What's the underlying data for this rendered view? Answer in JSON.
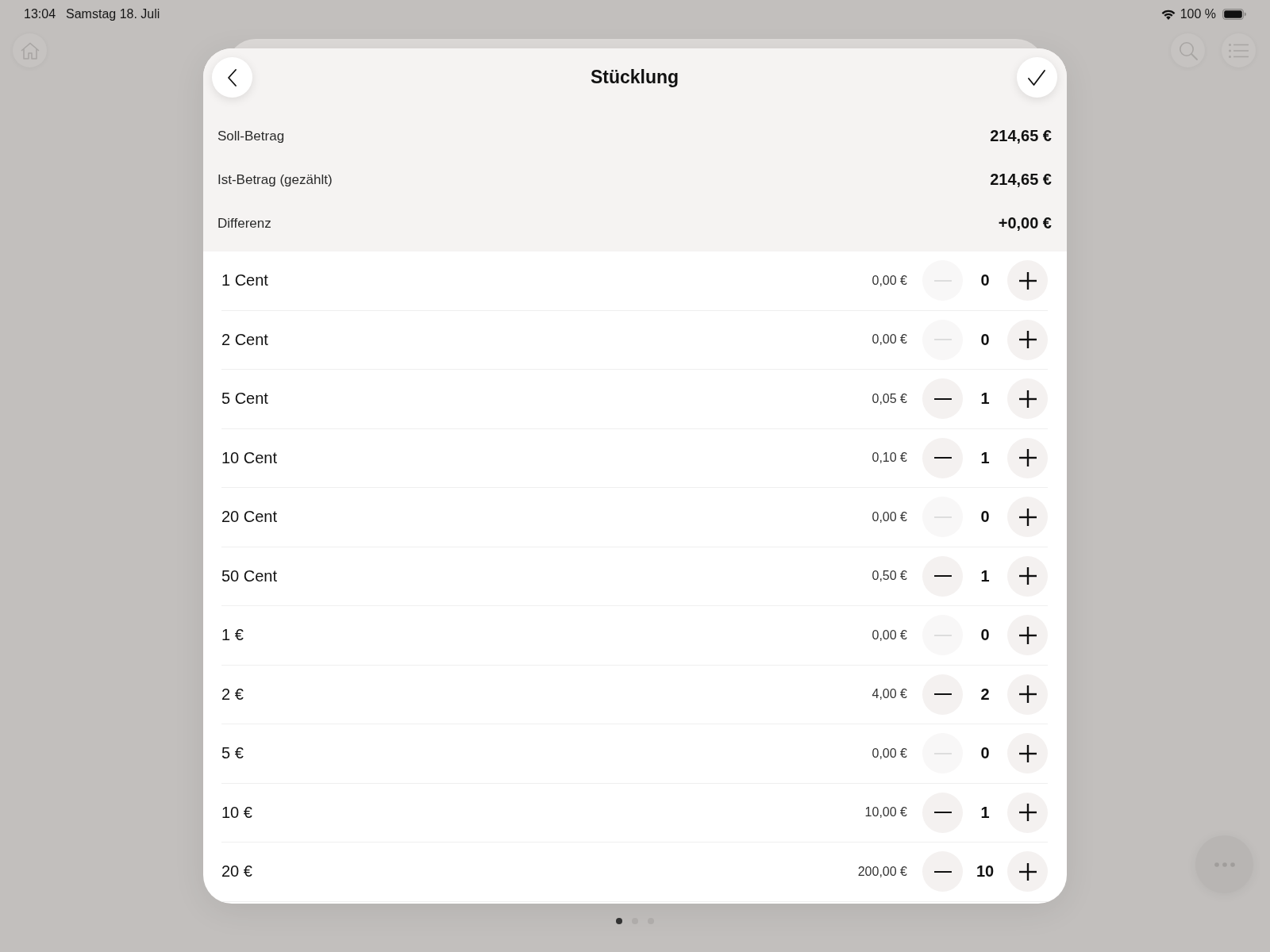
{
  "status_bar": {
    "time": "13:04",
    "date": "Samstag 18. Juli",
    "battery": "100 %"
  },
  "sheet": {
    "title": "Stücklung"
  },
  "summary": [
    {
      "label": "Soll-Betrag",
      "value": "214,65 €"
    },
    {
      "label": "Ist-Betrag (gezählt)",
      "value": "214,65 €"
    },
    {
      "label": "Differenz",
      "value": "+0,00 €"
    }
  ],
  "denominations": [
    {
      "name": "1 Cent",
      "amount": "0,00 €",
      "count": "0",
      "minus_disabled": true
    },
    {
      "name": "2 Cent",
      "amount": "0,00 €",
      "count": "0",
      "minus_disabled": true
    },
    {
      "name": "5 Cent",
      "amount": "0,05 €",
      "count": "1",
      "minus_disabled": false
    },
    {
      "name": "10 Cent",
      "amount": "0,10 €",
      "count": "1",
      "minus_disabled": false
    },
    {
      "name": "20 Cent",
      "amount": "0,00 €",
      "count": "0",
      "minus_disabled": true
    },
    {
      "name": "50 Cent",
      "amount": "0,50 €",
      "count": "1",
      "minus_disabled": false
    },
    {
      "name": "1 €",
      "amount": "0,00 €",
      "count": "0",
      "minus_disabled": true
    },
    {
      "name": "2 €",
      "amount": "4,00 €",
      "count": "2",
      "minus_disabled": false
    },
    {
      "name": "5 €",
      "amount": "0,00 €",
      "count": "0",
      "minus_disabled": true
    },
    {
      "name": "10 €",
      "amount": "10,00 €",
      "count": "1",
      "minus_disabled": false
    },
    {
      "name": "20 €",
      "amount": "200,00 €",
      "count": "10",
      "minus_disabled": false
    }
  ],
  "pager": [
    {
      "selected": true
    },
    {
      "selected": false
    },
    {
      "selected": false
    }
  ]
}
